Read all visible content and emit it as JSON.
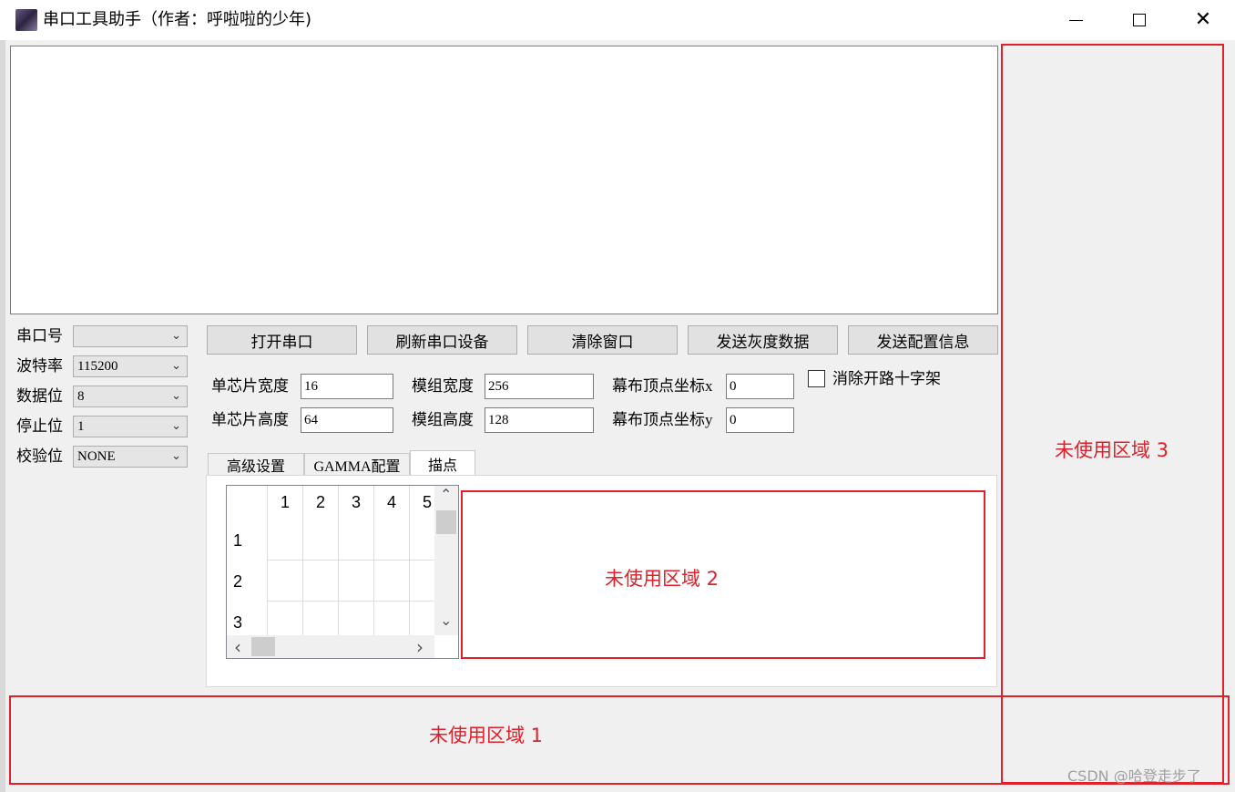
{
  "window": {
    "title": "串口工具助手（作者：呼啦啦的少年)",
    "min_glyph": "",
    "max_glyph": "",
    "close_glyph": "✕"
  },
  "serial": {
    "port": {
      "label": "串口号",
      "value": ""
    },
    "baud": {
      "label": "波特率",
      "value": "115200"
    },
    "databits": {
      "label": "数据位",
      "value": "8"
    },
    "stopbits": {
      "label": "停止位",
      "value": "1"
    },
    "parity": {
      "label": "校验位",
      "value": "NONE"
    }
  },
  "buttons": {
    "open_port": "打开串口",
    "refresh_devices": "刷新串口设备",
    "clear_window": "清除窗口",
    "send_gray": "发送灰度数据",
    "send_config": "发送配置信息"
  },
  "params": {
    "chip_width": {
      "label": "单芯片宽度",
      "value": "16"
    },
    "chip_height": {
      "label": "单芯片高度",
      "value": "64"
    },
    "module_width": {
      "label": "模组宽度",
      "value": "256"
    },
    "module_height": {
      "label": "模组高度",
      "value": "128"
    },
    "screen_x": {
      "label": "幕布顶点坐标x",
      "value": "0"
    },
    "screen_y": {
      "label": "幕布顶点坐标y",
      "value": "0"
    },
    "remove_cross": "消除开路十字架"
  },
  "tabs": [
    "高级设置",
    "GAMMA配置",
    "描点"
  ],
  "grid": {
    "columns": [
      "1",
      "2",
      "3",
      "4",
      "5"
    ],
    "rows": [
      "1",
      "2",
      "3"
    ]
  },
  "scroll_glyphs": {
    "up": "⌃",
    "down": "⌄",
    "left": "‹",
    "right": "›"
  },
  "annotations": {
    "area1": "未使用区域 1",
    "area2": "未使用区域  2",
    "area3": "未使用区域  3",
    "accent_color": "#e0202a"
  },
  "watermark": "CSDN @哈登走步了"
}
